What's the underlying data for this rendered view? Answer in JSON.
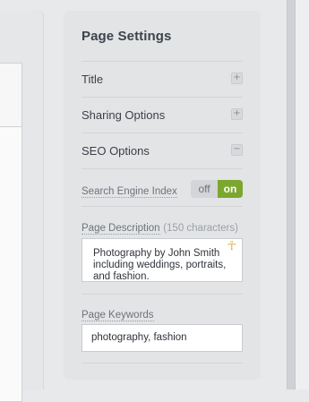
{
  "panel": {
    "title": "Page Settings",
    "sections": [
      {
        "label": "Title",
        "toggle": "+"
      },
      {
        "label": "Sharing Options",
        "toggle": "+"
      },
      {
        "label": "SEO Options",
        "toggle": "−"
      }
    ]
  },
  "seo": {
    "search_engine_index": {
      "label": "Search Engine Index",
      "off_label": "off",
      "on_label": "on",
      "state": "on"
    },
    "page_description": {
      "label": "Page Description",
      "hint": "(150 characters)",
      "value": "Photography by John Smith including weddings, portraits, and fashion.",
      "resize_icon": "ankh-resize-handle-icon"
    },
    "page_keywords": {
      "label": "Page Keywords",
      "value": "photography, fashion"
    }
  },
  "colors": {
    "panel_bg": "#e3e4e6",
    "on_green": "#7ba72e",
    "handle_gold": "#e0b646"
  }
}
